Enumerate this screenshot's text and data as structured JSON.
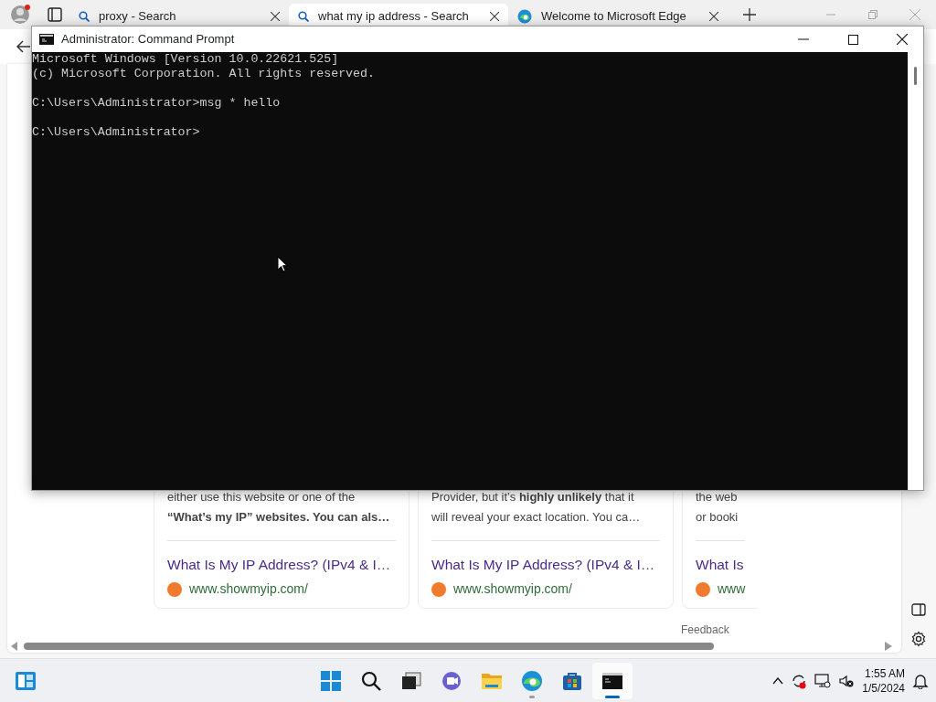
{
  "browser": {
    "tabs": [
      {
        "label": "proxy - Search",
        "kind": "search",
        "selected": false
      },
      {
        "label": "what my ip address - Search",
        "kind": "search",
        "selected": true
      },
      {
        "label": "Welcome to Microsoft Edge",
        "kind": "edge",
        "selected": false
      }
    ]
  },
  "results": {
    "cards": [
      {
        "lines": [
          "either use this website or one of the",
          "**“What’s my IP” websites. You can als…**"
        ],
        "link": "What Is My IP Address? (IPv4 & I…",
        "site": "www.showmyip.com/"
      },
      {
        "lines": [
          "Provider, but it’s **highly unlikely** that it",
          "will reveal your exact location. You ca…"
        ],
        "link": "What Is My IP Address? (IPv4 & I…",
        "site": "www.showmyip.com/"
      },
      {
        "lines": [
          "the web",
          "or booki"
        ],
        "link": "What Is",
        "site": "www"
      }
    ],
    "feedback": "Feedback"
  },
  "console_window": {
    "title": "Administrator: Command Prompt",
    "paragraphs": [
      [
        "Microsoft Windows [Version 10.0.22621.525]",
        "(c) Microsoft Corporation. All rights reserved."
      ],
      [
        "C:\\Users\\Administrator>msg * hello"
      ],
      [
        "C:\\Users\\Administrator>"
      ]
    ]
  },
  "taskbar": {
    "apps": [
      {
        "kind": "start",
        "running": false,
        "selected": false
      },
      {
        "kind": "search",
        "running": false,
        "selected": false
      },
      {
        "kind": "taskview",
        "running": false,
        "selected": false
      },
      {
        "kind": "chat",
        "running": false,
        "selected": false
      },
      {
        "kind": "explorer",
        "running": false,
        "selected": false
      },
      {
        "kind": "edge",
        "running": true,
        "selected": false
      },
      {
        "kind": "store",
        "running": false,
        "selected": false
      },
      {
        "kind": "terminal",
        "running": true,
        "selected": true
      }
    ],
    "clock": {
      "time": "1:55 AM",
      "date": "1/5/2024"
    }
  }
}
